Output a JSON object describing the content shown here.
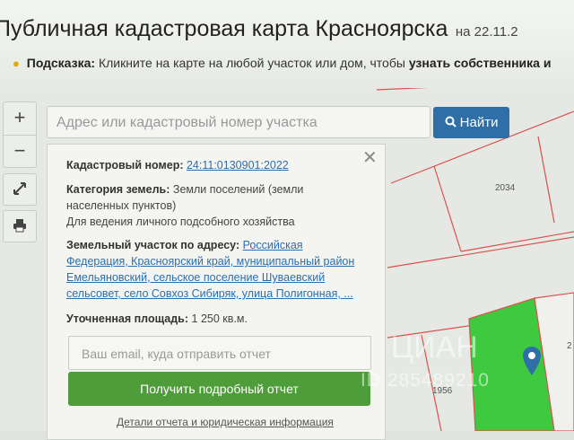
{
  "header": {
    "title": "Публичная кадастровая карта Красноярска",
    "date": "на 22.11.2",
    "hint_label": "Подсказка:",
    "hint_text": "Кликните на карте на любой участок или дом, чтобы",
    "hint_bold": "узнать собственника и"
  },
  "search": {
    "placeholder": "Адрес или кадастровый номер участка",
    "button_label": "Найти"
  },
  "controls": {
    "zoom_in": "+",
    "zoom_out": "−"
  },
  "popup": {
    "cadastral_label": "Кадастровый номер:",
    "cadastral_value": "24:11:0130901:2022",
    "category_label": "Категория земель:",
    "category_value_1": "Земли поселений (земли",
    "category_value_2": "населенных пунктов)",
    "usage": "Для ведения личного подсобного хозяйства",
    "address_label": "Земельный участок по адресу:",
    "address_1": "Российская",
    "address_2": "Федерация, Красноярский край, муниципальный район",
    "address_3": "Емельяновский, сельское поселение Шуваевский",
    "address_4": "сельсовет, село Совхоз Сибиряк, улица Полигонная, ...",
    "area_label": "Уточненная площадь:",
    "area_value": "1 250 кв.м.",
    "email_placeholder": "Ваш email, куда отправить отчет",
    "report_button": "Получить подробный отчет",
    "details_link": "Детали отчета и юридическая информация"
  },
  "map": {
    "plot_label_1": "2034",
    "plot_label_2": "1956",
    "plot_label_3": "2",
    "watermark": "ЦИАН",
    "watermark_id": "ID 285489210"
  },
  "colors": {
    "accent": "#2f6fa8",
    "report_button": "#4f9d3a",
    "parcel_border": "#d9534f",
    "selected_parcel": "#3fc93f"
  }
}
